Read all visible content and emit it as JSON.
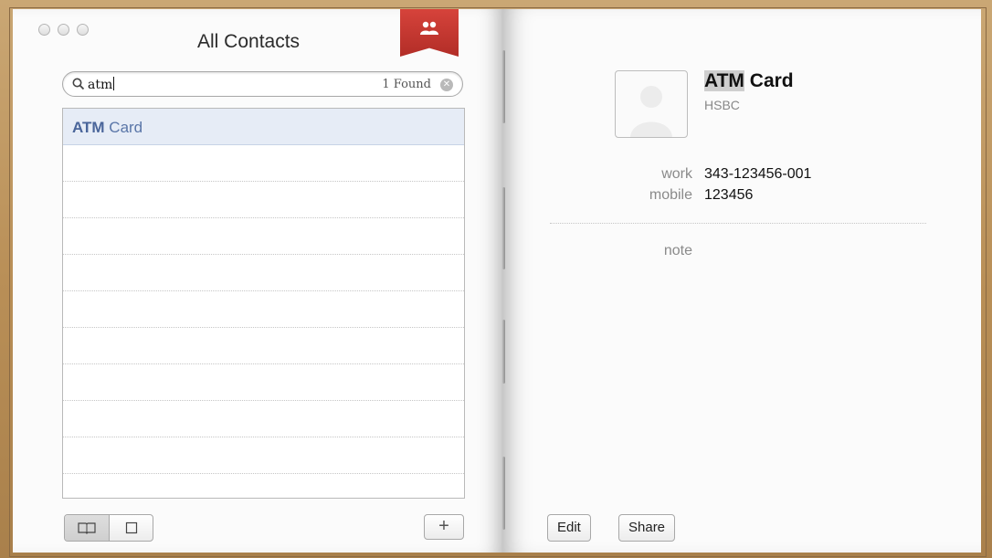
{
  "window": {
    "title": "All Contacts"
  },
  "search": {
    "query": "atm",
    "result_count": "1 Found"
  },
  "contact_list": {
    "items": [
      {
        "match": "ATM",
        "rest": " Card",
        "selected": true
      }
    ]
  },
  "contact": {
    "name_highlight": "ATM",
    "name_rest": " Card",
    "company": "HSBC",
    "fields": [
      {
        "label": "work",
        "value": "343-123456-001"
      },
      {
        "label": "mobile",
        "value": "123456"
      },
      {
        "label": "note",
        "value": ""
      }
    ]
  },
  "buttons": {
    "edit": "Edit",
    "share": "Share",
    "add": "+"
  },
  "icons": {
    "bookmark": "groups-icon",
    "search": "magnifier-icon",
    "clear": "clear-circle-icon",
    "view_book": "open-book-icon",
    "view_card": "card-icon"
  },
  "colors": {
    "bookmark": "#c0392f",
    "selection": "#e6ecf6",
    "link_text": "#5a76a8"
  }
}
